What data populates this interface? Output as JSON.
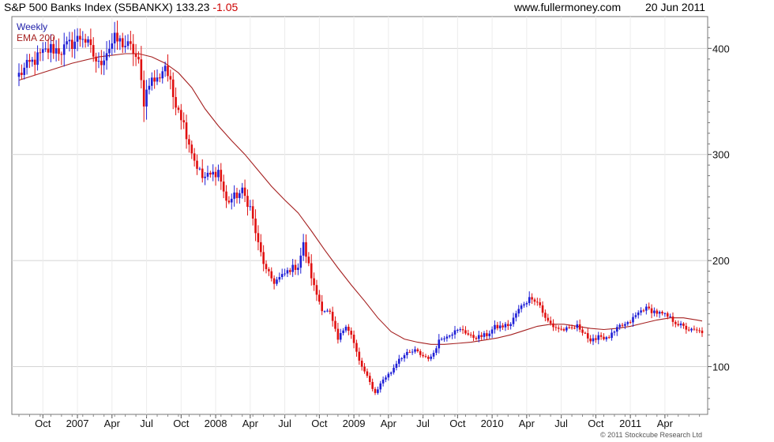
{
  "header": {
    "title": "S&P 500 Banks Index (S5BANKX)",
    "last": "133.23",
    "change": "-1.05",
    "site": "www.fullermoney.com",
    "date": "20 Jun 2011"
  },
  "legend": {
    "series1": "Weekly",
    "series2": "EMA 200"
  },
  "copyright": "© 2011 Stockcube Research Ltd",
  "colors": {
    "up": "#1f1fd6",
    "down": "#e01010",
    "ema": "#a52020",
    "legend_weekly": "#2222aa",
    "legend_ema": "#a52020",
    "grid": "#d4d4d4"
  },
  "chart_data": {
    "type": "candlestick",
    "interval": "Weekly",
    "ylim": [
      55,
      430
    ],
    "grid": true,
    "legend_position": "top-left",
    "y_ticks": [
      100,
      200,
      300,
      400
    ],
    "x_ticks": [
      "Oct",
      "2007",
      "Apr",
      "Jul",
      "Oct",
      "2008",
      "Apr",
      "Jul",
      "Oct",
      "2009",
      "Apr",
      "Jul",
      "Oct",
      "2010",
      "Apr",
      "Jul",
      "Oct",
      "2011",
      "Apr"
    ],
    "x_tick_weeks": [
      9,
      22,
      35,
      48,
      61,
      74,
      87,
      100,
      113,
      126,
      139,
      152,
      165,
      178,
      191,
      204,
      217,
      230,
      243
    ],
    "close_series": [
      [
        0,
        375
      ],
      [
        4,
        385
      ],
      [
        8,
        393
      ],
      [
        12,
        400
      ],
      [
        16,
        398
      ],
      [
        20,
        405
      ],
      [
        24,
        412
      ],
      [
        27,
        398
      ],
      [
        30,
        384
      ],
      [
        33,
        398
      ],
      [
        36,
        408
      ],
      [
        39,
        405
      ],
      [
        43,
        398
      ],
      [
        45,
        385
      ],
      [
        47,
        350
      ],
      [
        49,
        370
      ],
      [
        52,
        370
      ],
      [
        55,
        385
      ],
      [
        58,
        355
      ],
      [
        60,
        345
      ],
      [
        63,
        320
      ],
      [
        66,
        295
      ],
      [
        69,
        278
      ],
      [
        72,
        280
      ],
      [
        75,
        285
      ],
      [
        78,
        255
      ],
      [
        81,
        260
      ],
      [
        84,
        265
      ],
      [
        87,
        250
      ],
      [
        90,
        215
      ],
      [
        93,
        190
      ],
      [
        96,
        180
      ],
      [
        99,
        185
      ],
      [
        102,
        192
      ],
      [
        105,
        195
      ],
      [
        107,
        215
      ],
      [
        109,
        195
      ],
      [
        111,
        175
      ],
      [
        114,
        155
      ],
      [
        117,
        150
      ],
      [
        120,
        125
      ],
      [
        123,
        140
      ],
      [
        125,
        130
      ],
      [
        128,
        105
      ],
      [
        131,
        90
      ],
      [
        134,
        75
      ],
      [
        137,
        88
      ],
      [
        140,
        95
      ],
      [
        143,
        108
      ],
      [
        146,
        112
      ],
      [
        149,
        115
      ],
      [
        152,
        110
      ],
      [
        155,
        108
      ],
      [
        158,
        125
      ],
      [
        161,
        130
      ],
      [
        164,
        133
      ],
      [
        167,
        135
      ],
      [
        170,
        128
      ],
      [
        173,
        128
      ],
      [
        176,
        130
      ],
      [
        179,
        137
      ],
      [
        182,
        138
      ],
      [
        185,
        140
      ],
      [
        187,
        150
      ],
      [
        190,
        160
      ],
      [
        193,
        166
      ],
      [
        196,
        158
      ],
      [
        198,
        145
      ],
      [
        201,
        138
      ],
      [
        204,
        135
      ],
      [
        207,
        135
      ],
      [
        210,
        138
      ],
      [
        213,
        132
      ],
      [
        215,
        122
      ],
      [
        218,
        130
      ],
      [
        221,
        126
      ],
      [
        224,
        132
      ],
      [
        226,
        138
      ],
      [
        229,
        140
      ],
      [
        232,
        148
      ],
      [
        235,
        155
      ],
      [
        238,
        153
      ],
      [
        241,
        150
      ],
      [
        244,
        147
      ],
      [
        247,
        142
      ],
      [
        250,
        137
      ],
      [
        253,
        134
      ],
      [
        256,
        133
      ]
    ],
    "ema_series": [
      [
        0,
        370
      ],
      [
        10,
        378
      ],
      [
        20,
        386
      ],
      [
        30,
        392
      ],
      [
        40,
        395
      ],
      [
        45,
        395
      ],
      [
        50,
        392
      ],
      [
        55,
        386
      ],
      [
        60,
        377
      ],
      [
        65,
        363
      ],
      [
        70,
        343
      ],
      [
        75,
        327
      ],
      [
        80,
        313
      ],
      [
        85,
        300
      ],
      [
        90,
        285
      ],
      [
        95,
        270
      ],
      [
        100,
        257
      ],
      [
        105,
        245
      ],
      [
        110,
        228
      ],
      [
        115,
        210
      ],
      [
        120,
        193
      ],
      [
        125,
        177
      ],
      [
        130,
        162
      ],
      [
        135,
        146
      ],
      [
        140,
        133
      ],
      [
        145,
        126
      ],
      [
        150,
        123
      ],
      [
        155,
        121
      ],
      [
        160,
        121
      ],
      [
        165,
        122
      ],
      [
        170,
        123
      ],
      [
        175,
        125
      ],
      [
        180,
        127
      ],
      [
        185,
        130
      ],
      [
        190,
        134
      ],
      [
        195,
        138
      ],
      [
        200,
        140
      ],
      [
        205,
        140
      ],
      [
        210,
        138
      ],
      [
        215,
        136
      ],
      [
        220,
        135
      ],
      [
        225,
        136
      ],
      [
        230,
        138
      ],
      [
        235,
        141
      ],
      [
        240,
        144
      ],
      [
        245,
        146
      ],
      [
        250,
        146
      ],
      [
        255,
        144
      ],
      [
        257,
        143
      ]
    ]
  }
}
